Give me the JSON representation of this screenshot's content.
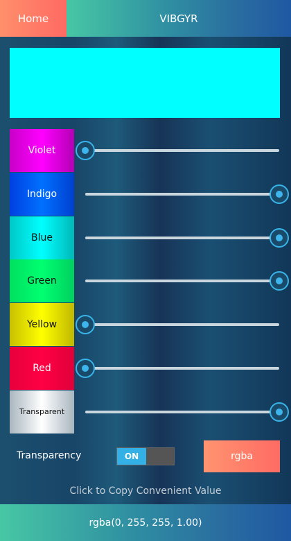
{
  "header": {
    "home_label": "Home",
    "title": "VIBGYR"
  },
  "preview": {
    "color": "#00ffff"
  },
  "colors": [
    {
      "label": "Violet",
      "value": 0,
      "text_color": "#ffffff",
      "swatch": "linear-gradient(90deg,#c800c8,#ff00ff 50%,#b400b4)"
    },
    {
      "label": "Indigo",
      "value": 1,
      "text_color": "#ffffff",
      "swatch": "linear-gradient(90deg,#0040e0,#0070ff 50%,#0040d0)"
    },
    {
      "label": "Blue",
      "value": 1,
      "text_color": "#111111",
      "swatch": "linear-gradient(90deg,#00c8c8,#00ffff 50%,#00b8b8)"
    },
    {
      "label": "Green",
      "value": 1,
      "text_color": "#111111",
      "swatch": "linear-gradient(90deg,#00e060,#00ff70 50%,#00d060)"
    },
    {
      "label": "Yellow",
      "value": 0,
      "text_color": "#111111",
      "swatch": "linear-gradient(90deg,#c8c000,#ffff00 50%,#c0b800)"
    },
    {
      "label": "Red",
      "value": 0,
      "text_color": "#ffffff",
      "swatch": "linear-gradient(90deg,#e8003c,#ff0044 50%,#e0003a)"
    },
    {
      "label": "Transparent",
      "value": 1,
      "text_color": "#111111",
      "swatch": "linear-gradient(90deg,#a9b6bf,#ffffff 50%,#a9b6bf)"
    }
  ],
  "controls": {
    "transparency_label": "Transparency",
    "toggle_state": "ON",
    "format_button": "rgba"
  },
  "hint": "Click to Copy Convenient Value",
  "output": "rgba(0, 255, 255, 1.00)"
}
